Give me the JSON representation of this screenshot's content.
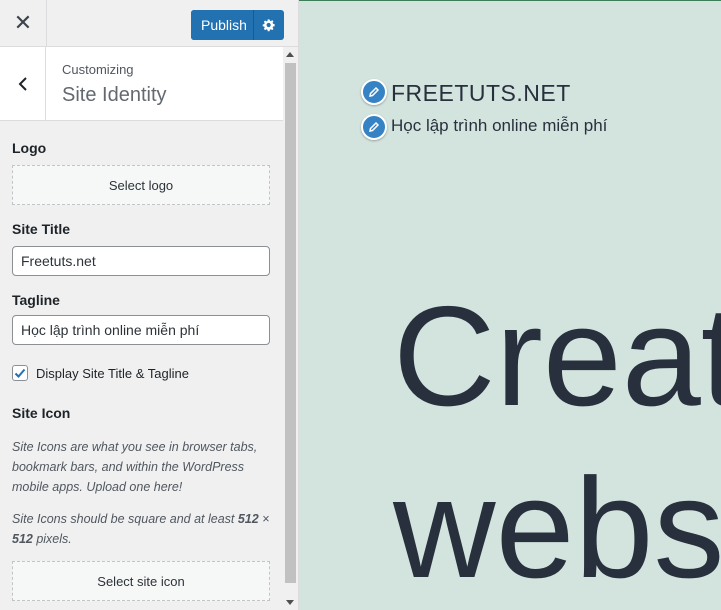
{
  "header": {
    "close_glyph": "✕",
    "publish_label": "Publish"
  },
  "section": {
    "crumb": "Customizing",
    "title": "Site Identity"
  },
  "panel": {
    "logo": {
      "label": "Logo",
      "button": "Select logo"
    },
    "site_title": {
      "label": "Site Title",
      "value": "Freetuts.net"
    },
    "tagline": {
      "label": "Tagline",
      "value": "Học lập trình online miễn phí"
    },
    "display_checkbox": {
      "label": "Display Site Title & Tagline",
      "checked": true
    },
    "site_icon": {
      "label": "Site Icon",
      "desc1": "Site Icons are what you see in browser tabs, bookmark bars, and within the WordPress mobile apps. Upload one here!",
      "desc2_pre": "Site Icons should be square and at least ",
      "desc2_bold1": "512",
      "desc2_mid": " × ",
      "desc2_bold2": "512",
      "desc2_post": " pixels.",
      "button": "Select site icon"
    }
  },
  "preview": {
    "site_title": "FREETUTS.NET",
    "tagline": "Học lập trình online miễn phí",
    "hero_line1": "Create",
    "hero_line2": "website"
  },
  "colors": {
    "accent": "#2271b1",
    "preview_bg": "#d3e4df",
    "pencil": "#3582c4"
  }
}
